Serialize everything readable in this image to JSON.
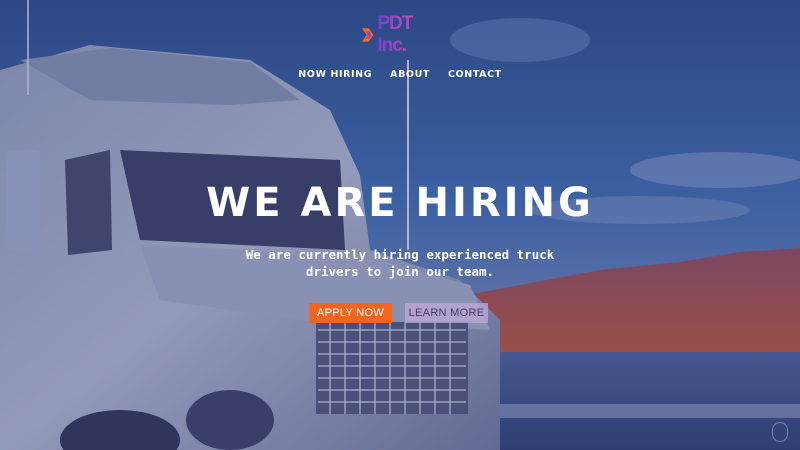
{
  "brand": {
    "logo_text": "PDT Inc.",
    "colors": {
      "primary": "#f2651f",
      "accent_purple": "#7a3fd0",
      "secondary_button_bg": "#bfaad7"
    }
  },
  "nav": {
    "items": [
      {
        "label": "NOW HIRING"
      },
      {
        "label": "ABOUT"
      },
      {
        "label": "CONTACT"
      }
    ]
  },
  "hero": {
    "headline": "WE ARE HIRING",
    "subtext": "We are currently hiring experienced truck drivers to join our team.",
    "primary_cta": "APPLY NOW",
    "secondary_cta": "LEARN MORE",
    "background_icon": "truck-photo"
  }
}
